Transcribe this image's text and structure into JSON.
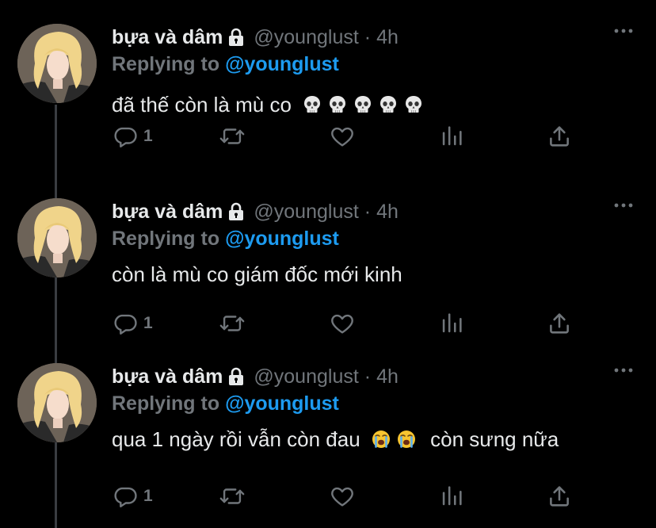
{
  "tweets": [
    {
      "name": "bựa và dâm",
      "handle": "@younglust",
      "separator": "·",
      "time": "4h",
      "reply_prefix": "Replying to",
      "reply_to": "@younglust",
      "text": "đã thế còn là mù co",
      "emojis": [
        "skull-emoji",
        "skull-emoji",
        "skull-emoji",
        "skull-emoji",
        "skull-emoji"
      ],
      "text_after": "",
      "reply_count": "1"
    },
    {
      "name": "bựa và dâm",
      "handle": "@younglust",
      "separator": "·",
      "time": "4h",
      "reply_prefix": "Replying to",
      "reply_to": "@younglust",
      "text": "còn là mù co giám đốc mới kinh",
      "emojis": [],
      "text_after": "",
      "reply_count": "1"
    },
    {
      "name": "bựa và dâm",
      "handle": "@younglust",
      "separator": "·",
      "time": "4h",
      "reply_prefix": "Replying to",
      "reply_to": "@younglust",
      "text": "qua 1 ngày rồi vẫn còn đau",
      "emojis": [
        "loudly-crying-emoji",
        "loudly-crying-emoji"
      ],
      "text_after": "còn sưng nữa",
      "reply_count": "1"
    }
  ],
  "icons": {
    "lock": "lock-icon",
    "more": "more-icon",
    "reply": "reply-icon",
    "retweet": "retweet-icon",
    "like": "like-icon",
    "analytics": "analytics-icon",
    "share": "share-icon"
  },
  "colors": {
    "background": "#000000",
    "text": "#e7e9ea",
    "muted": "#71767b",
    "accent": "#1d9bf0",
    "thread_line": "#3a3d41"
  }
}
